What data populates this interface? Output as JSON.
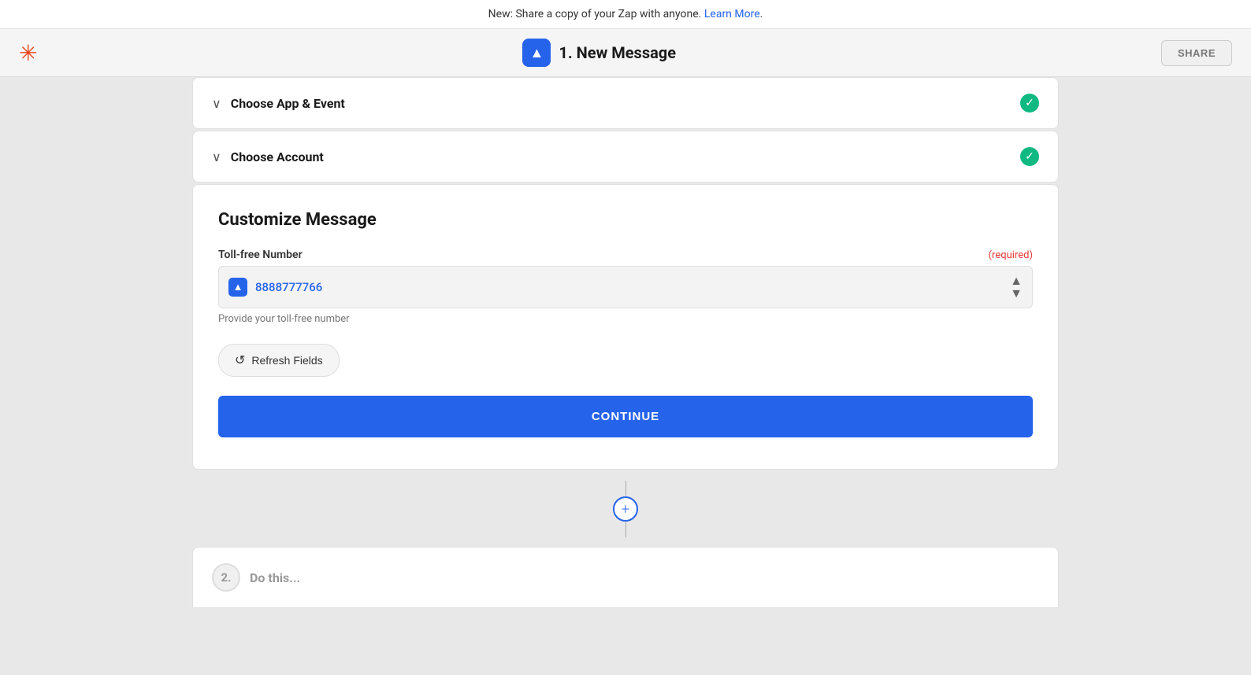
{
  "banner": {
    "text": "New: Share a copy of your Zap with anyone.",
    "link_text": "Learn More",
    "suffix": "."
  },
  "header": {
    "title": "1. New Message",
    "share_label": "SHARE",
    "app_icon": "▲"
  },
  "sections": {
    "choose_app": {
      "title": "Choose App & Event",
      "completed": true
    },
    "choose_account": {
      "title": "Choose Account",
      "completed": true
    }
  },
  "customize": {
    "title": "Customize Message",
    "field": {
      "label": "Toll-free Number",
      "required_label": "(required)",
      "value": "8888777766",
      "hint": "Provide your toll-free number"
    },
    "refresh_button": "Refresh Fields",
    "continue_button": "CONTINUE"
  },
  "add_step": {
    "icon": "+"
  },
  "step2": {
    "number": "2.",
    "label": "Do this..."
  },
  "icons": {
    "chevron": "∨",
    "check": "✓",
    "refresh": "↺",
    "up_arrow": "▲",
    "sort_arrows": "⇅"
  }
}
